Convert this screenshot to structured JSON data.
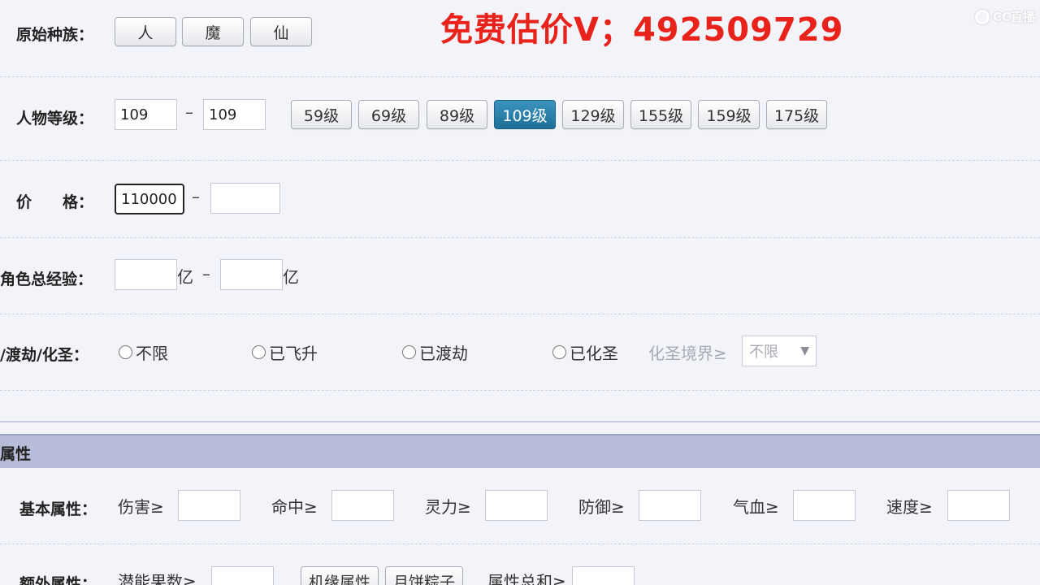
{
  "promo_text": "免费估价V；492509729",
  "watermark_label": "CC直播",
  "race": {
    "label": "原始种族：",
    "options": [
      "人",
      "魔",
      "仙"
    ]
  },
  "level": {
    "label": "人物等级：",
    "min": "109",
    "max": "109",
    "separator": "–",
    "presets": [
      "59级",
      "69级",
      "89级",
      "109级",
      "129级",
      "155级",
      "159级",
      "175级"
    ],
    "active_preset": "109级"
  },
  "price": {
    "label": "价　　格：",
    "min": "110000",
    "max": "",
    "separator": "–"
  },
  "experience": {
    "label": "角色总经验：",
    "unit": "亿",
    "separator": "–",
    "min": "",
    "max": ""
  },
  "ascension": {
    "label": "/渡劫/化圣：",
    "options": [
      "不限",
      "已飞升",
      "已渡劫",
      "已化圣"
    ],
    "realm_label": "化圣境界≥",
    "realm_value": "不限"
  },
  "attributes": {
    "section_title": "属性",
    "basic_label": "基本属性：",
    "basic_fields": [
      "伤害≥",
      "命中≥",
      "灵力≥",
      "防御≥",
      "气血≥",
      "速度≥"
    ],
    "extra_label": "额外属性：",
    "potential_label": "潜能果数≥",
    "button_fate": "机缘属性",
    "button_mooncake": "月饼粽子",
    "sum_label": "属性总和≥"
  },
  "colors": {
    "promo": "#e8231c",
    "active_button": "#1f6f97",
    "section_bar": "#b7bdd8"
  }
}
